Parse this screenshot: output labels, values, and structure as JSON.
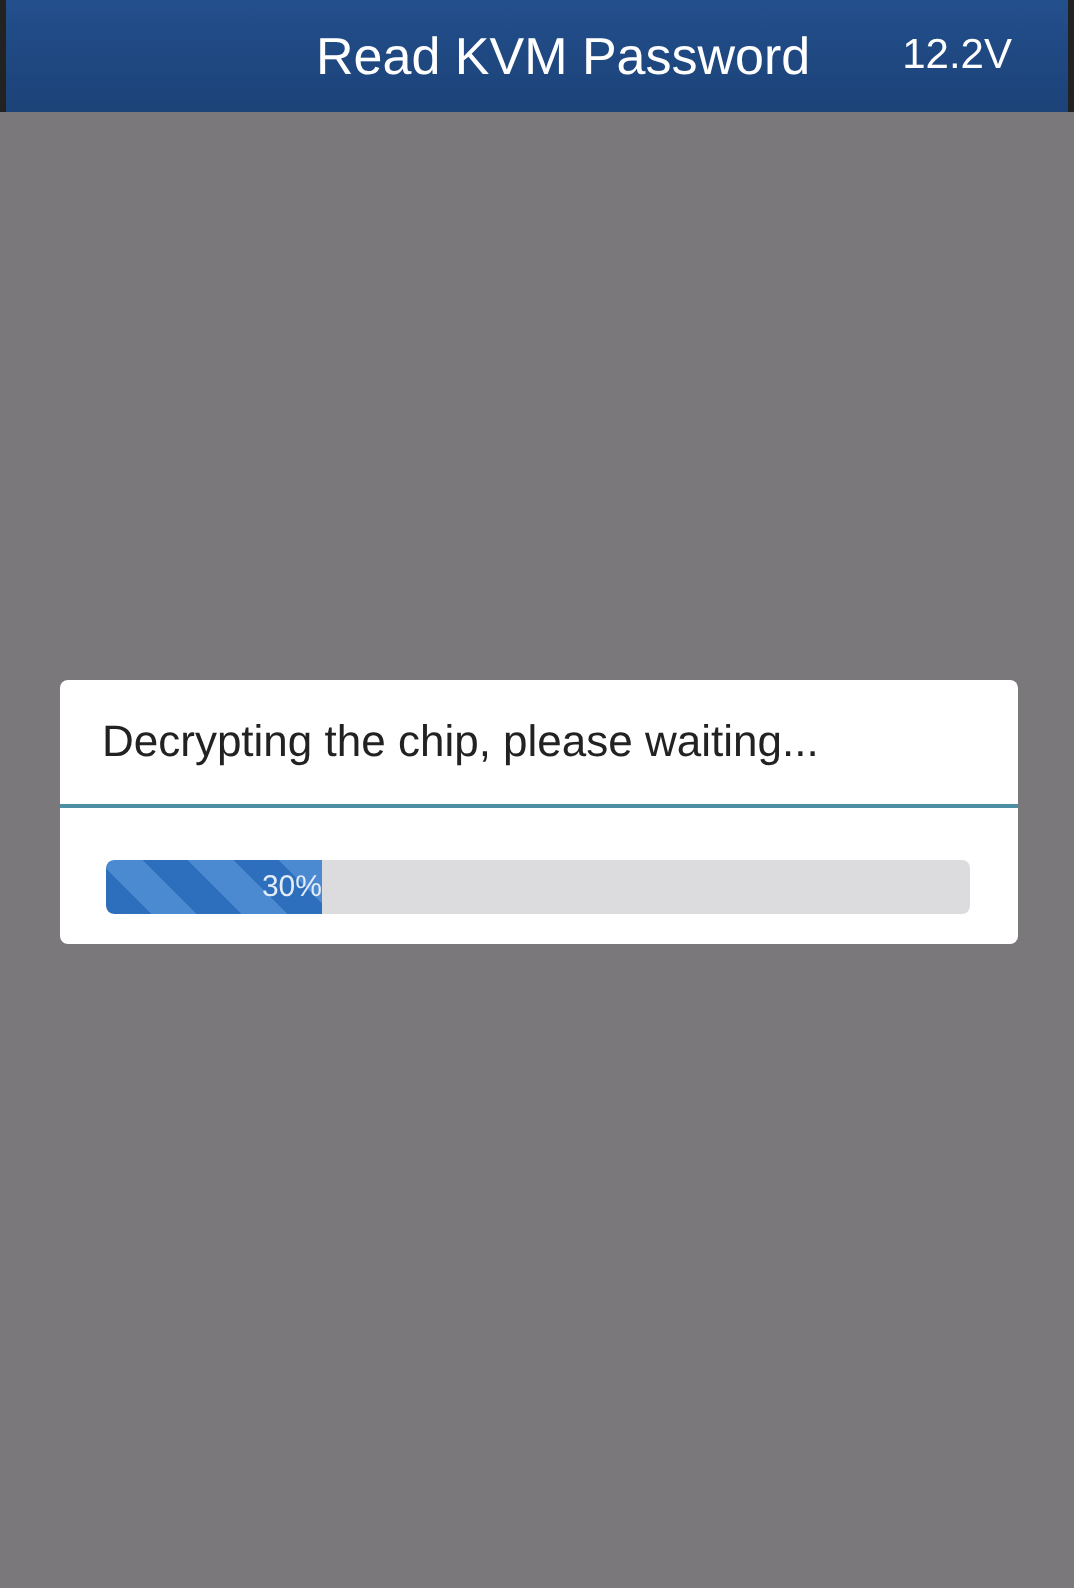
{
  "header": {
    "title": "Read KVM Password",
    "voltage": "12.2V"
  },
  "dialog": {
    "message": "Decrypting the chip, please waiting...",
    "progress": {
      "level": 0.25,
      "reading": "30%"
    }
  }
}
